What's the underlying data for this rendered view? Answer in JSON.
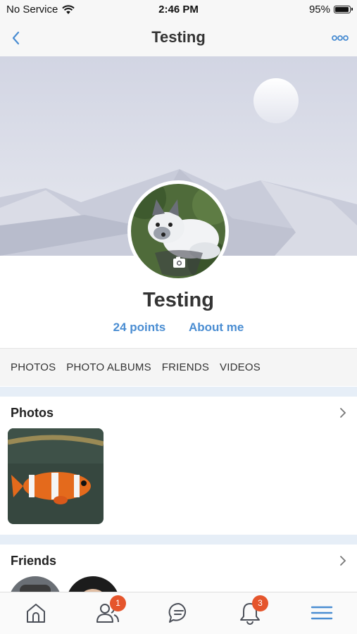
{
  "status_bar": {
    "carrier": "No Service",
    "time": "2:46 PM",
    "battery": "95%",
    "battery_level": 0.95
  },
  "nav": {
    "title": "Testing",
    "back_icon": "chevron-left-icon",
    "more_icon": "more-dots-icon"
  },
  "profile": {
    "name": "Testing",
    "points_label": "24 points",
    "about_label": "About me",
    "camera_icon": "camera-icon"
  },
  "tabs": [
    "PHOTOS",
    "PHOTO ALBUMS",
    "FRIENDS",
    "VIDEOS"
  ],
  "sections": {
    "photos": {
      "title": "Photos"
    },
    "friends": {
      "title": "Friends"
    }
  },
  "tab_bar": {
    "items": [
      {
        "icon": "home-icon"
      },
      {
        "icon": "friends-icon",
        "badge": "1"
      },
      {
        "icon": "messages-icon"
      },
      {
        "icon": "notifications-icon",
        "badge": "3"
      },
      {
        "icon": "menu-icon"
      }
    ]
  },
  "colors": {
    "accent": "#4a8dd2",
    "badge": "#e5552c",
    "separator": "#e6eef7"
  }
}
